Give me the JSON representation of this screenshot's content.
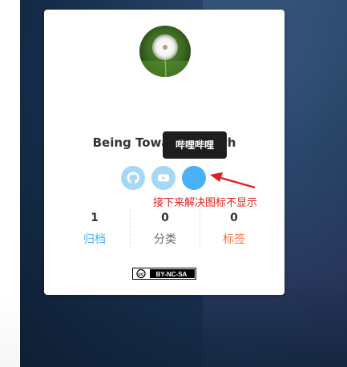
{
  "author": {
    "name": "Being Towards Death",
    "avatar_icon": "dandelion-avatar"
  },
  "tooltip": {
    "text": "哔哩哔哩"
  },
  "social_links": [
    {
      "name": "github",
      "icon": "github-icon",
      "color": "#a6d7f5"
    },
    {
      "name": "youtube",
      "icon": "youtube-icon",
      "color": "#a6d7f5"
    },
    {
      "name": "bilibili",
      "icon": "missing-icon",
      "color": "#49b1f5"
    }
  ],
  "annotation": {
    "text": "接下来解决图标不显示",
    "color": "#e02020"
  },
  "stats": [
    {
      "count": "1",
      "label": "归档",
      "color": "#49b1f5"
    },
    {
      "count": "0",
      "label": "分类",
      "color": "#666666"
    },
    {
      "count": "0",
      "label": "标签",
      "color": "#ff7242"
    }
  ],
  "license": {
    "badge_text": "BY-NC-SA",
    "badge_prefix": "cc"
  }
}
